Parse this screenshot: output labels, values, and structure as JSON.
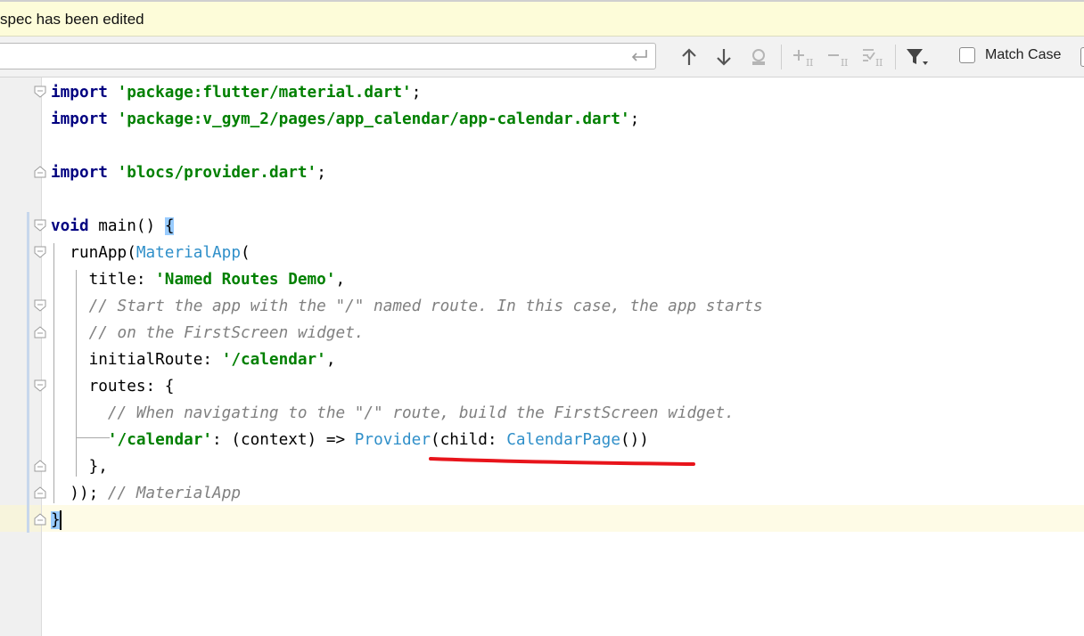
{
  "banner": {
    "text": "spec has been edited"
  },
  "findbar": {
    "search_value": "",
    "match_case_label": "Match Case",
    "icons": [
      "enter-icon",
      "arrow-up-icon",
      "arrow-down-icon",
      "find-all-occurrences-icon",
      "add-occurrence-icon",
      "remove-occurrence-icon",
      "select-all-occurrences-icon",
      "filter-icon"
    ]
  },
  "editor": {
    "lines": {
      "l1_kw": "import",
      "l1_str": "'package:flutter/material.dart'",
      "l1_end": ";",
      "l2_kw": "import",
      "l2_str": "'package:v_gym_2/pages/app_calendar/app-calendar.dart'",
      "l2_end": ";",
      "l4_kw": "import",
      "l4_str": "'blocs/provider.dart'",
      "l4_end": ";",
      "l6_kw": "void",
      "l6_name": " main() ",
      "l6_brace": "{",
      "l7_a": "  runApp(",
      "l7_cls": "MaterialApp",
      "l7_b": "(",
      "l8_a": "    title: ",
      "l8_str": "'Named Routes Demo'",
      "l8_b": ",",
      "l9_cmt": "    // Start the app with the \"/\" named route. In this case, the app starts",
      "l10_cmt": "    // on the FirstScreen widget.",
      "l11_a": "    initialRoute: ",
      "l11_str": "'/calendar'",
      "l11_b": ",",
      "l12_a": "    routes: {",
      "l13_cmt": "      // When navigating to the \"/\" route, build the FirstScreen widget.",
      "l14_pad": "      ",
      "l14_str": "'/calendar'",
      "l14_a": ": (context) => ",
      "l14_cls1": "Provider",
      "l14_b": "(child: ",
      "l14_cls2": "CalendarPage",
      "l14_c": "())",
      "l15_a": "    },",
      "l16_a": "  )); ",
      "l16_cmt": "// MaterialApp",
      "l17_brace": "}"
    }
  },
  "colors": {
    "keyword": "#000080",
    "string": "#008000",
    "comment": "#808080",
    "class_ref": "#2f8fc9",
    "annotation_underline": "#e8141b",
    "banner_bg": "#fdfcd9"
  }
}
